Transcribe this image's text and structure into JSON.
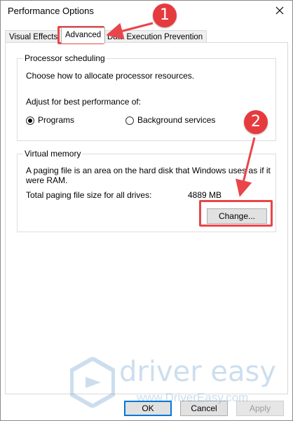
{
  "window": {
    "title": "Performance Options",
    "close_icon": "close-icon"
  },
  "tabs": [
    {
      "label": "Visual Effects",
      "active": false
    },
    {
      "label": "Advanced",
      "active": true
    },
    {
      "label": "Data Execution Prevention",
      "active": false
    }
  ],
  "processor_scheduling": {
    "group_label": "Processor scheduling",
    "description": "Choose how to allocate processor resources.",
    "adjust_label": "Adjust for best performance of:",
    "options": [
      {
        "label": "Programs",
        "selected": true
      },
      {
        "label": "Background services",
        "selected": false
      }
    ]
  },
  "virtual_memory": {
    "group_label": "Virtual memory",
    "description_line1": "A paging file is an area on the hard disk that Windows uses as if it",
    "description_line2": "were RAM.",
    "total_label": "Total paging file size for all drives:",
    "total_value": "4889 MB",
    "change_button": "Change..."
  },
  "footer": {
    "ok": "OK",
    "cancel": "Cancel",
    "apply": "Apply"
  },
  "annotations": {
    "step1": "1",
    "step2": "2",
    "color": "#e8464a"
  },
  "watermark": {
    "title": "driver easy",
    "url": "www.DriverEasy.com"
  }
}
